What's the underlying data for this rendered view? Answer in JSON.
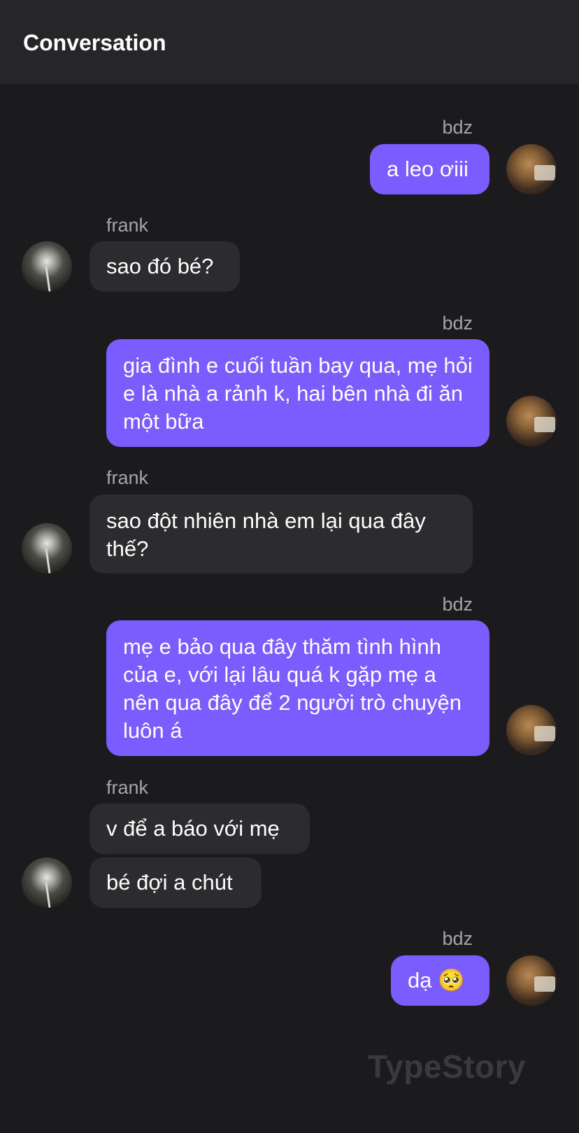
{
  "header": {
    "title": "Conversation"
  },
  "messages": [
    {
      "sender": "bdz",
      "text": "a leo ơiii"
    },
    {
      "sender": "frank",
      "text": "sao đó bé?"
    },
    {
      "sender": "bdz",
      "text": "gia đình e cuối tuần bay qua, mẹ hỏi e là nhà a rảnh k, hai bên nhà đi ăn một bữa"
    },
    {
      "sender": "frank",
      "text": "sao đột nhiên nhà em lại qua đây thế?"
    },
    {
      "sender": "bdz",
      "text": "mẹ e bảo qua đây thăm tình hình của e, với lại lâu quá k gặp mẹ a nên qua đây để 2 người trò chuyện luôn á"
    },
    {
      "sender": "frank",
      "text": "v để a báo với mẹ"
    },
    {
      "sender": "frank",
      "text": "bé đợi a chút"
    },
    {
      "sender": "bdz",
      "text": "dạ 🥺"
    }
  ],
  "watermark": "TypeStory"
}
